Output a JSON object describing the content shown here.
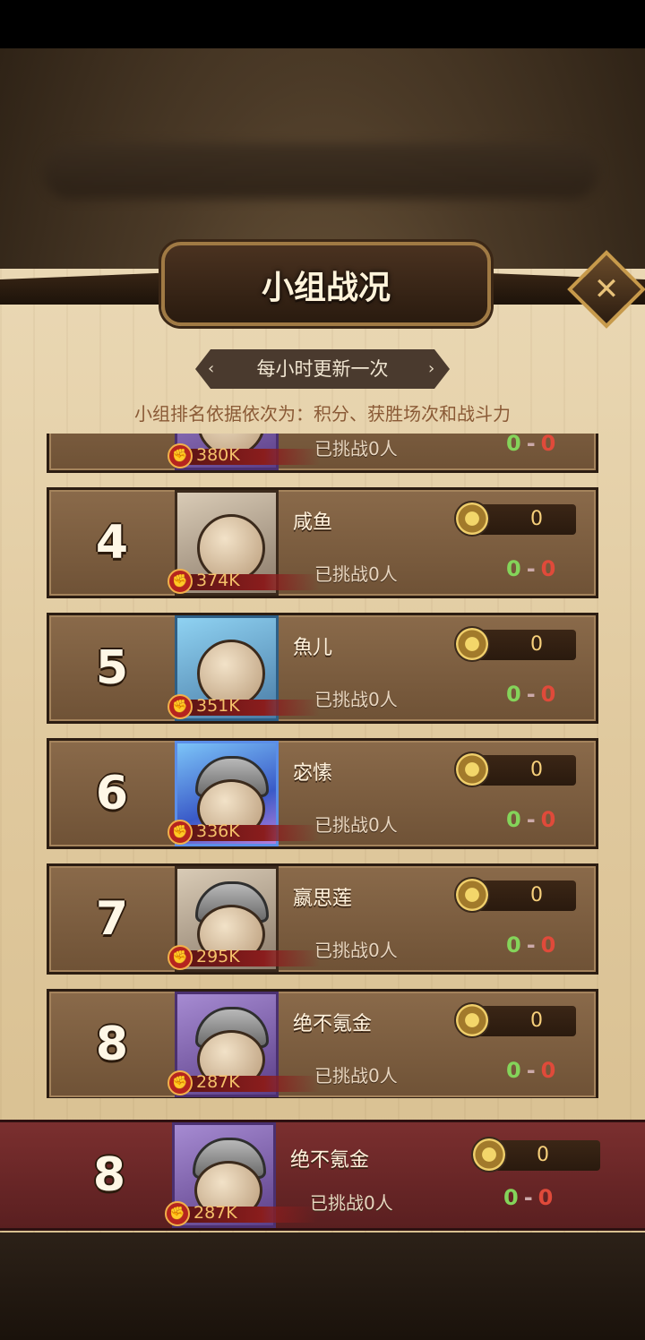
{
  "header": {
    "title": "小组战况"
  },
  "update_notice": "每小时更新一次",
  "ranking_rule": "小组排名依据依次为：积分、获胜场次和战斗力",
  "list": [
    {
      "rank": "",
      "name": "",
      "power": "380K",
      "score": "",
      "challenged": "已挑战0人",
      "wins": "0",
      "losses": "0",
      "partial": true
    },
    {
      "rank": "4",
      "name": "咸鱼",
      "power": "374K",
      "score": "0",
      "challenged": "已挑战0人",
      "wins": "0",
      "losses": "0"
    },
    {
      "rank": "5",
      "name": "魚儿",
      "power": "351K",
      "score": "0",
      "challenged": "已挑战0人",
      "wins": "0",
      "losses": "0"
    },
    {
      "rank": "6",
      "name": "宓愫",
      "power": "336K",
      "score": "0",
      "challenged": "已挑战0人",
      "wins": "0",
      "losses": "0"
    },
    {
      "rank": "7",
      "name": "嬴思莲",
      "power": "295K",
      "score": "0",
      "challenged": "已挑战0人",
      "wins": "0",
      "losses": "0"
    },
    {
      "rank": "8",
      "name": "绝不氪金",
      "power": "287K",
      "score": "0",
      "challenged": "已挑战0人",
      "wins": "0",
      "losses": "0"
    }
  ],
  "self": {
    "rank": "8",
    "name": "绝不氪金",
    "power": "287K",
    "score": "0",
    "challenged": "已挑战0人",
    "wins": "0",
    "losses": "0"
  },
  "icons": {
    "close": "close-icon",
    "power": "fist-icon",
    "score": "medal-icon",
    "arrows": [
      "chevron-left-icon",
      "chevron-right-icon"
    ]
  },
  "colors": {
    "win": "#84d45a",
    "loss": "#e04a3a",
    "power_text": "#f4c06a",
    "self_row": "#7b2f2f"
  }
}
